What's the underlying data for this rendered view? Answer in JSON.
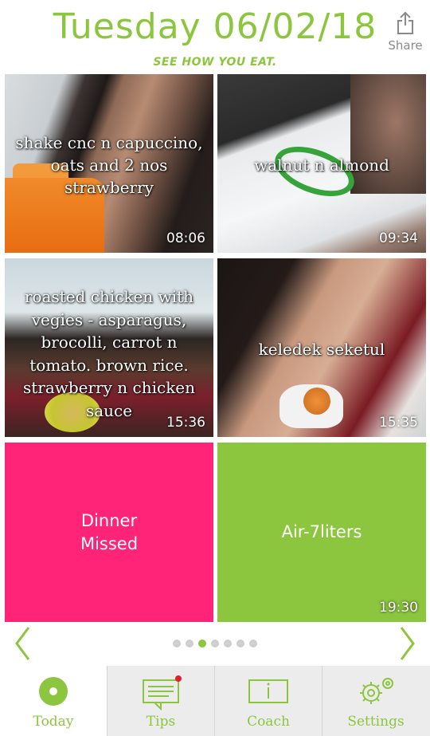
{
  "header": {
    "title": "Tuesday 06/02/18",
    "subtitle": "SEE HOW YOU EAT.",
    "share_label": "Share"
  },
  "meals": [
    {
      "caption": "shake cnc n capuccino, oats and 2 nos strawberry",
      "time": "08:06"
    },
    {
      "caption": "walnut n almond",
      "time": "09:34"
    },
    {
      "caption": "roasted chicken with vegies - asparagus, brocolli, carrot n tomato. brown rice. strawberry n chicken sauce",
      "time": "15:36"
    },
    {
      "caption": "keledek seketul",
      "time": "15:35"
    },
    {
      "label_line1": "Dinner",
      "label_line2": "Missed",
      "color": "#ff2478"
    },
    {
      "label": "Air-7liters",
      "time": "19:30",
      "color": "#8cc63f"
    }
  ],
  "pager": {
    "total": 7,
    "active_index": 2
  },
  "tabs": [
    {
      "label": "Today",
      "icon": "today-icon"
    },
    {
      "label": "Tips",
      "icon": "tips-icon"
    },
    {
      "label": "Coach",
      "icon": "coach-icon"
    },
    {
      "label": "Settings",
      "icon": "settings-icon"
    }
  ],
  "colors": {
    "accent": "#8cc63f",
    "pink": "#ff2478",
    "tab_bg": "#ececec",
    "notification": "#e0202a"
  }
}
